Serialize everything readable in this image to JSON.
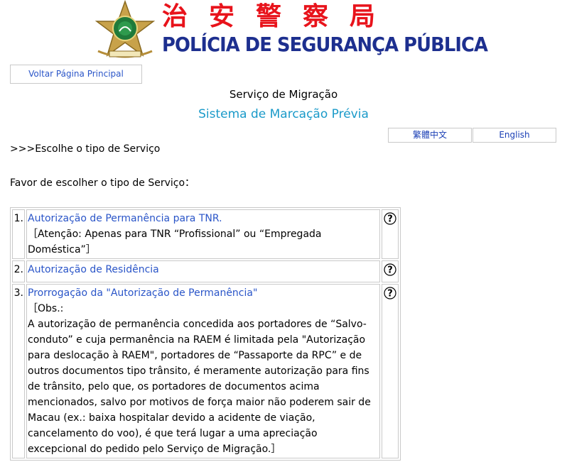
{
  "header": {
    "chinese_title": "治安警察局",
    "portuguese_title": "POLÍCIA DE SEGURANÇA PÚBLICA",
    "emblem_icon": "psp-emblem-icon"
  },
  "nav": {
    "home_label": "Voltar Página Principal"
  },
  "page": {
    "service_name": "Serviço de Migração",
    "system_name": "Sistema de Marcação Prévia",
    "step": ">>>Escolhe o tipo de Serviço",
    "instruction": "Favor de escolher o tipo de Serviço："
  },
  "languages": {
    "chinese": "繁體中文",
    "english": "English"
  },
  "services": [
    {
      "number": "1.",
      "title": "Autorização de Permanência para TNR.",
      "note": "［Atenção: Apenas para TNR “Profissional” ou “Empregada Doméstica”］"
    },
    {
      "number": "2.",
      "title": "Autorização de Residência",
      "note": ""
    },
    {
      "number": "3.",
      "title": "Prorrogação da \"Autorização de Permanência\"",
      "note_prefix": "［Obs.:",
      "note": "A autorização de permanência concedida aos portadores de “Salvo-conduto” e cuja permanência na RAEM é limitada pela \"Autorização para deslocação à RAEM\", portadores de “Passaporte da RPC” e de outros documentos tipo trânsito, é meramente autorização para fins de trânsito, pelo que, os portadores de documentos acima mencionados, salvo por motivos de força maior não poderem sair de Macau (ex.: baixa hospitalar devido a acidente de viação, cancelamento do voo), é que terá lugar a uma apreciação excepcional do pedido pelo Serviço de Migração.］"
    }
  ],
  "colors": {
    "chinese_title": "#e8131b",
    "portuguese_title": "#1d2f8f",
    "system_name": "#1a9ac9",
    "link": "#2a55c8"
  }
}
